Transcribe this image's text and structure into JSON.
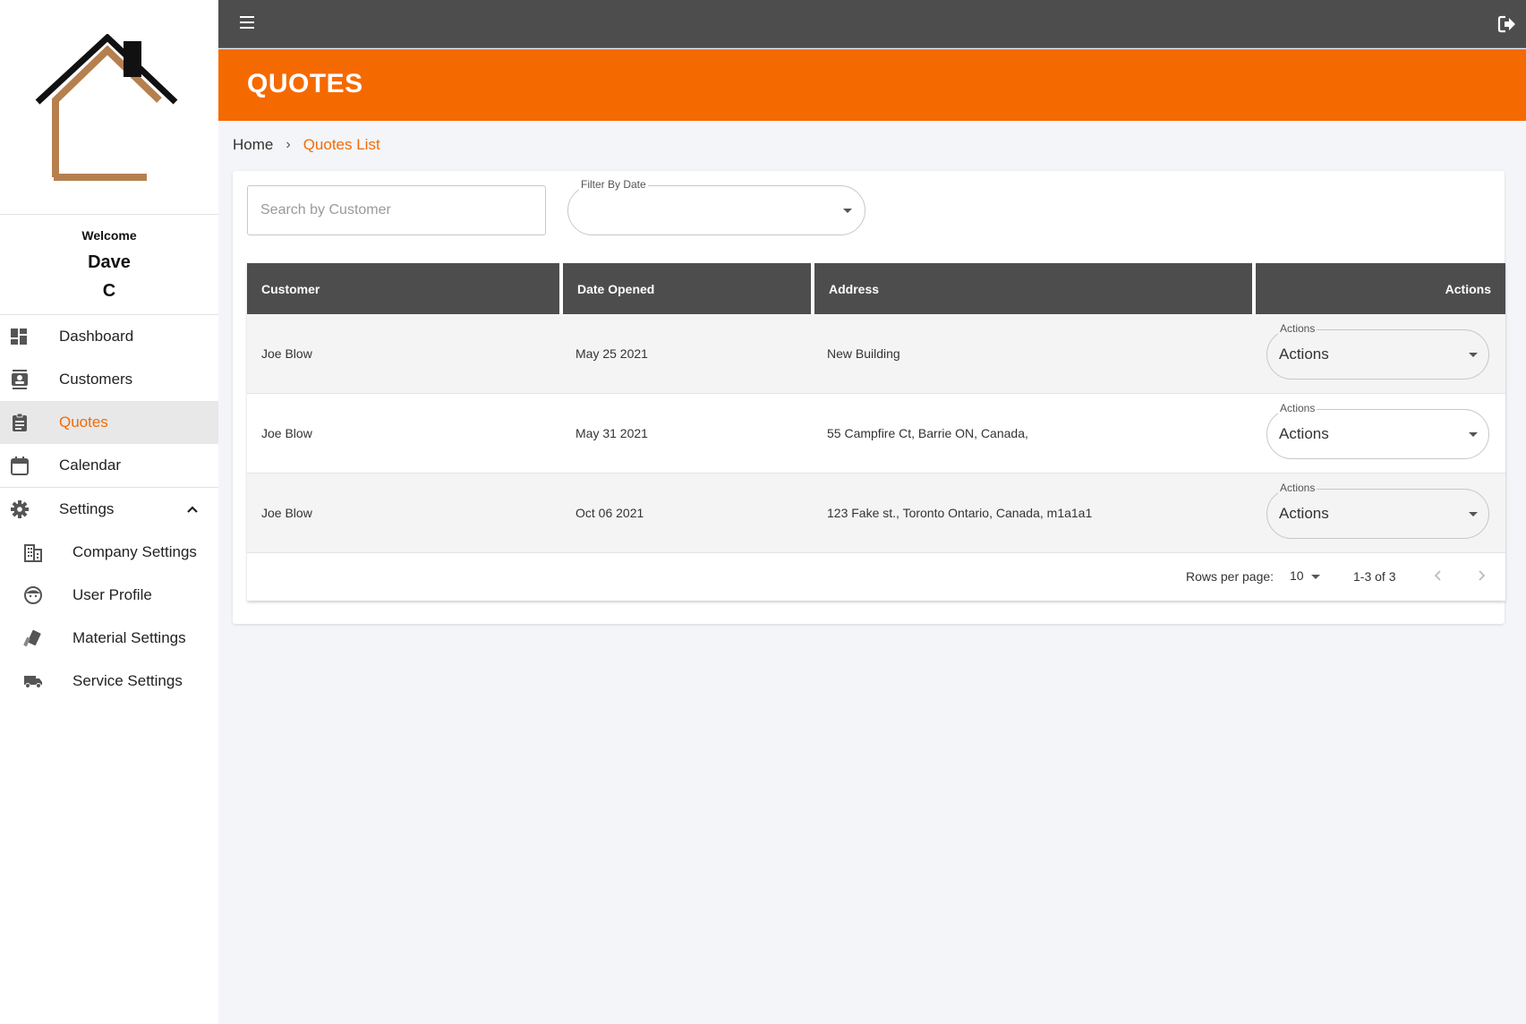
{
  "sidebar": {
    "welcome_label": "Welcome",
    "user_first": "Dave",
    "user_last": "C",
    "items": [
      {
        "label": "Dashboard",
        "icon": "dashboard-icon"
      },
      {
        "label": "Customers",
        "icon": "customers-icon"
      },
      {
        "label": "Quotes",
        "icon": "quotes-icon",
        "active": true
      },
      {
        "label": "Calendar",
        "icon": "calendar-icon"
      }
    ],
    "settings": {
      "label": "Settings",
      "icon": "gear-icon",
      "expanded": true,
      "children": [
        {
          "label": "Company Settings",
          "icon": "building-icon"
        },
        {
          "label": "User Profile",
          "icon": "face-icon"
        },
        {
          "label": "Material Settings",
          "icon": "material-icon"
        },
        {
          "label": "Service Settings",
          "icon": "truck-icon"
        }
      ]
    }
  },
  "header": {
    "title": "QUOTES"
  },
  "breadcrumb": {
    "home": "Home",
    "current": "Quotes List"
  },
  "filters": {
    "search_placeholder": "Search by Customer",
    "search_value": "",
    "date_label": "Filter By Date",
    "date_value": ""
  },
  "table": {
    "columns": [
      "Customer",
      "Date Opened",
      "Address",
      "Actions"
    ],
    "rows": [
      {
        "customer": "Joe Blow",
        "date": "May 25 2021",
        "address": "New Building",
        "actions_label": "Actions",
        "actions_value": "Actions"
      },
      {
        "customer": "Joe Blow",
        "date": "May 31 2021",
        "address": "55 Campfire Ct, Barrie ON, Canada,",
        "actions_label": "Actions",
        "actions_value": "Actions"
      },
      {
        "customer": "Joe Blow",
        "date": "Oct 06 2021",
        "address": "123 Fake st., Toronto Ontario, Canada, m1a1a1",
        "actions_label": "Actions",
        "actions_value": "Actions"
      }
    ]
  },
  "pagination": {
    "rows_per_page_label": "Rows per page:",
    "rows_per_page": "10",
    "range": "1-3 of 3"
  },
  "colors": {
    "accent": "#f56a00",
    "topbar": "#4d4d4d",
    "logo_dark": "#111111",
    "logo_brown": "#b5804e"
  }
}
